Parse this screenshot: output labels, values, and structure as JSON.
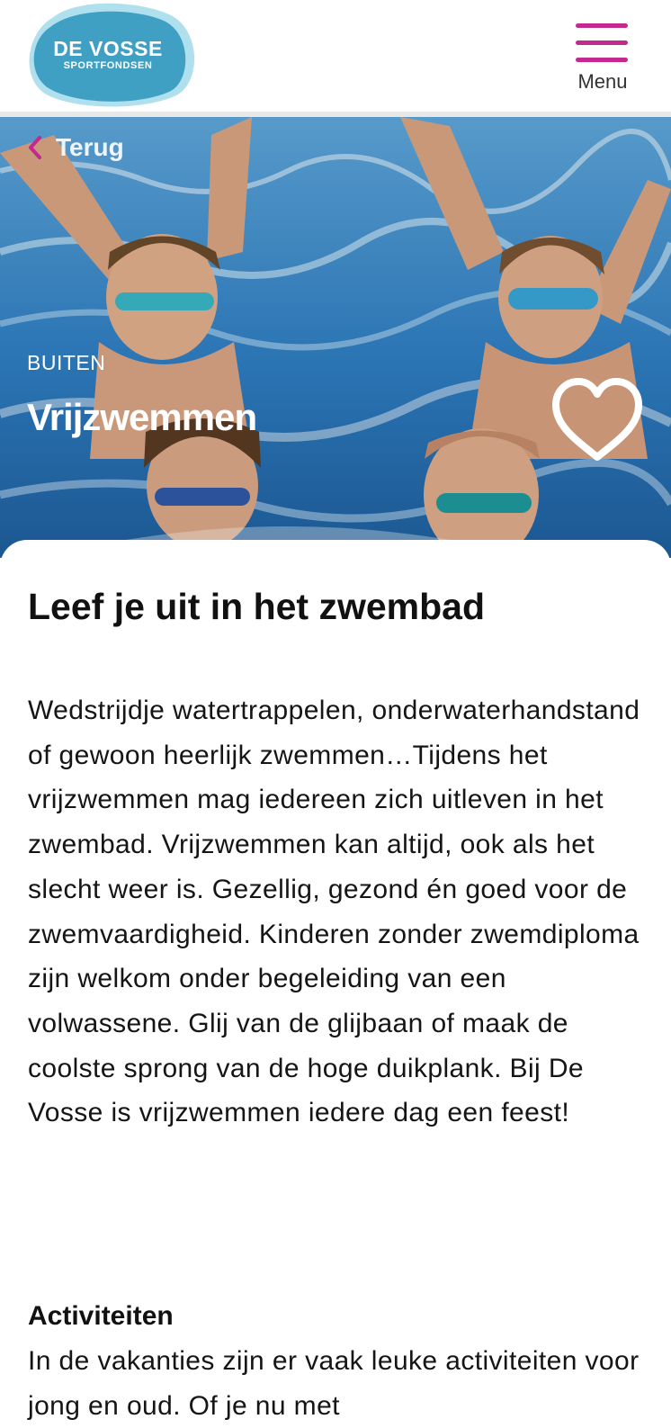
{
  "header": {
    "logo": {
      "title": "DE VOSSE",
      "subtitle": "SPORTFONDSEN"
    },
    "menu_label": "Menu"
  },
  "colors": {
    "accent": "#c22a8f",
    "logo_blue": "#4aa6c8",
    "water": "#3b8fcf"
  },
  "hero": {
    "back_label": "Terug",
    "category": "BUITEN",
    "title": "Vrijzwemmen",
    "favorite_icon": "heart-outline-icon"
  },
  "content": {
    "heading": "Leef je uit in het zwembad",
    "body": "Wedstrijdje watertrappelen, onderwaterhandstand of gewoon heerlijk zwemmen…Tijdens het vrijzwemmen mag iedereen zich uitleven in het zwembad. Vrijzwemmen kan altijd, ook als het slecht weer is. Gezellig, gezond én goed voor de zwemvaardigheid. Kinderen zonder zwemdiploma zijn welkom onder begeleiding van een volwassene. Glij van de glijbaan of maak de coolste sprong van de hoge duikplank. Bij De Vosse is vrijzwemmen iedere dag een feest!",
    "activities_heading": "Activiteiten",
    "activities_body": "In de vakanties zijn er vaak leuke activiteiten voor jong en oud. Of je nu met"
  }
}
